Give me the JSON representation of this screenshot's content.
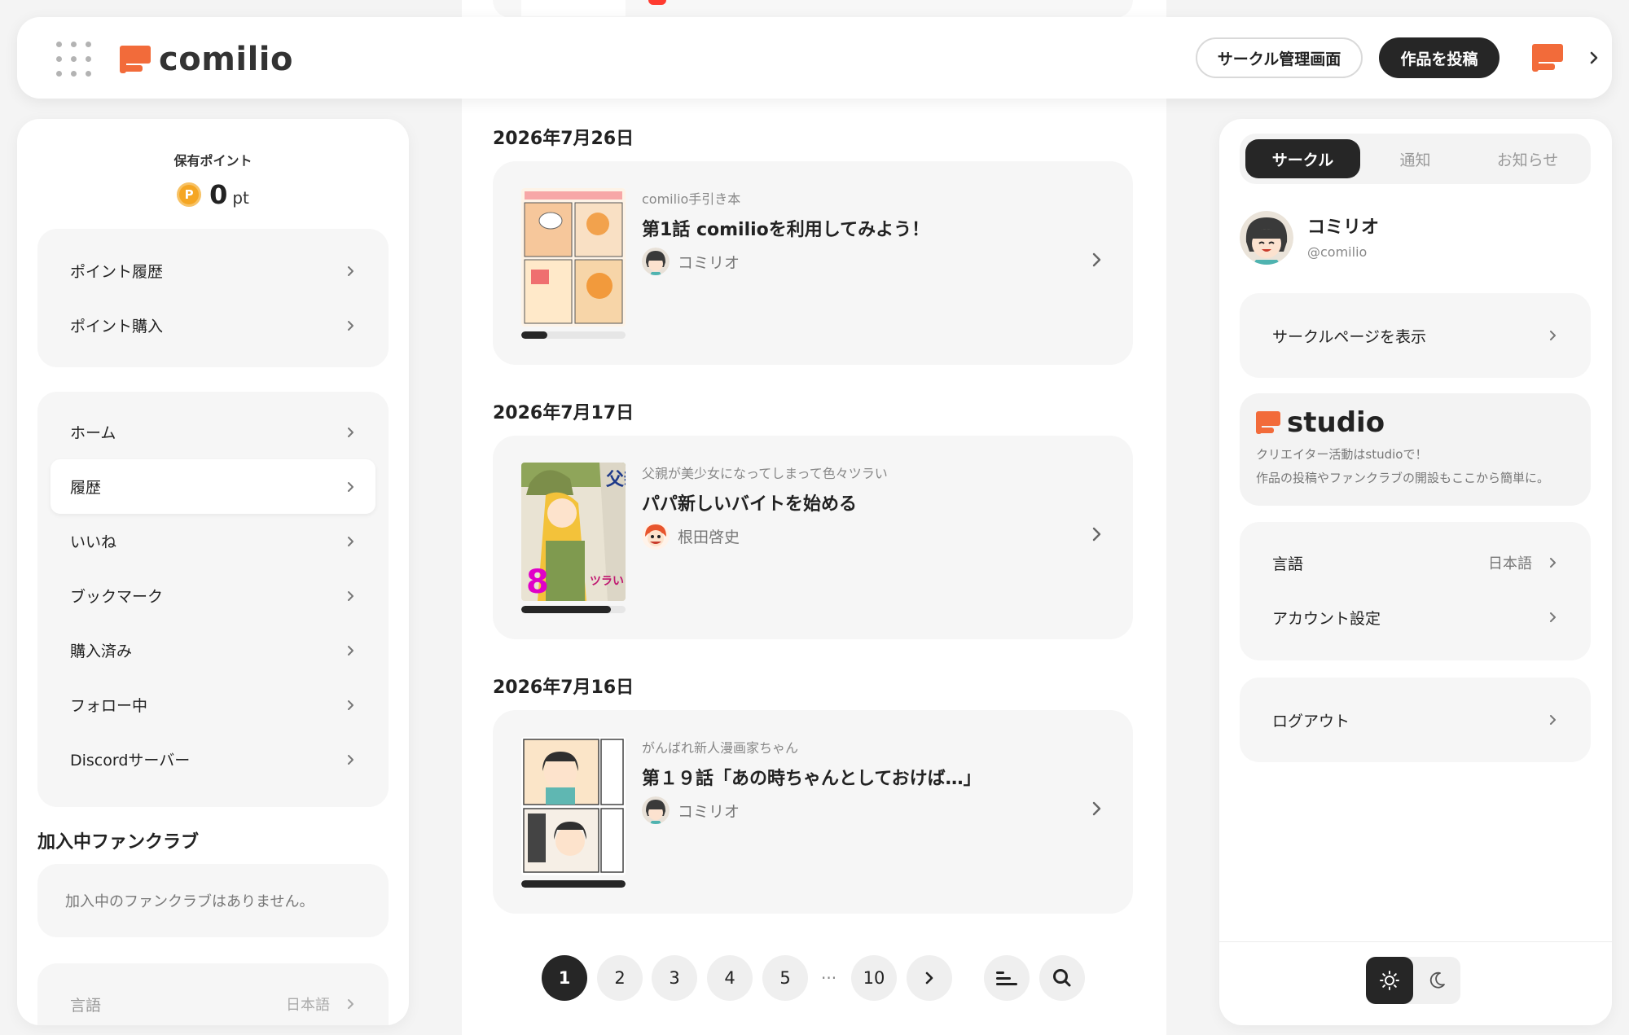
{
  "header": {
    "logo_text": "comilio",
    "circle_admin_label": "サークル管理画面",
    "post_label": "作品を投稿"
  },
  "left": {
    "points_label": "保有ポイント",
    "points_coin": "P",
    "points_value": "0",
    "points_unit": "pt",
    "points_menu": [
      {
        "label": "ポイント履歴"
      },
      {
        "label": "ポイント購入"
      }
    ],
    "nav_menu": [
      {
        "label": "ホーム"
      },
      {
        "label": "履歴"
      },
      {
        "label": "いいね"
      },
      {
        "label": "ブックマーク"
      },
      {
        "label": "購入済み"
      },
      {
        "label": "フォロー中"
      },
      {
        "label": "Discordサーバー"
      }
    ],
    "fanclub_title": "加入中ファンクラブ",
    "fanclub_empty": "加入中のファンクラブはありません。",
    "language_label": "言語",
    "language_value": "日本語"
  },
  "feed": [
    {
      "date": "2026年7月26日",
      "series": "comilio手引き本",
      "title": "第1話 comilioを利用してみよう！",
      "author": "コミリオ",
      "progress": 0.25
    },
    {
      "date": "2026年7月17日",
      "series": "父親が美少女になってしまって色々ツラい",
      "title": "パパ新しいバイトを始める",
      "author": "根田啓史",
      "progress": 0.86,
      "thumb_title": "父親が美少女",
      "thumb_number": "8",
      "thumb_sub": "ツラい"
    },
    {
      "date": "2026年7月16日",
      "series": "がんばれ新人漫画家ちゃん",
      "title": "第１９話「あの時ちゃんとしておけば…」",
      "author": "コミリオ",
      "progress": 1.0
    }
  ],
  "pagination": {
    "pages": [
      "1",
      "2",
      "3",
      "4",
      "5"
    ],
    "ellipsis": "···",
    "last": "10",
    "current": "1"
  },
  "right": {
    "tabs": [
      {
        "label": "サークル"
      },
      {
        "label": "通知"
      },
      {
        "label": "お知らせ"
      }
    ],
    "profile_name": "コミリオ",
    "profile_handle": "@comilio",
    "circle_page_label": "サークルページを表示",
    "studio_text": "studio",
    "studio_desc_1": "クリエイター活動はstudioで！",
    "studio_desc_2": "作品の投稿やファンクラブの開設もここから簡単に。",
    "language_label": "言語",
    "language_value": "日本語",
    "account_label": "アカウント設定",
    "logout_label": "ログアウト"
  },
  "colors": {
    "brand": "#f26b3a",
    "dark": "#262626",
    "panel": "#f6f6f6"
  }
}
